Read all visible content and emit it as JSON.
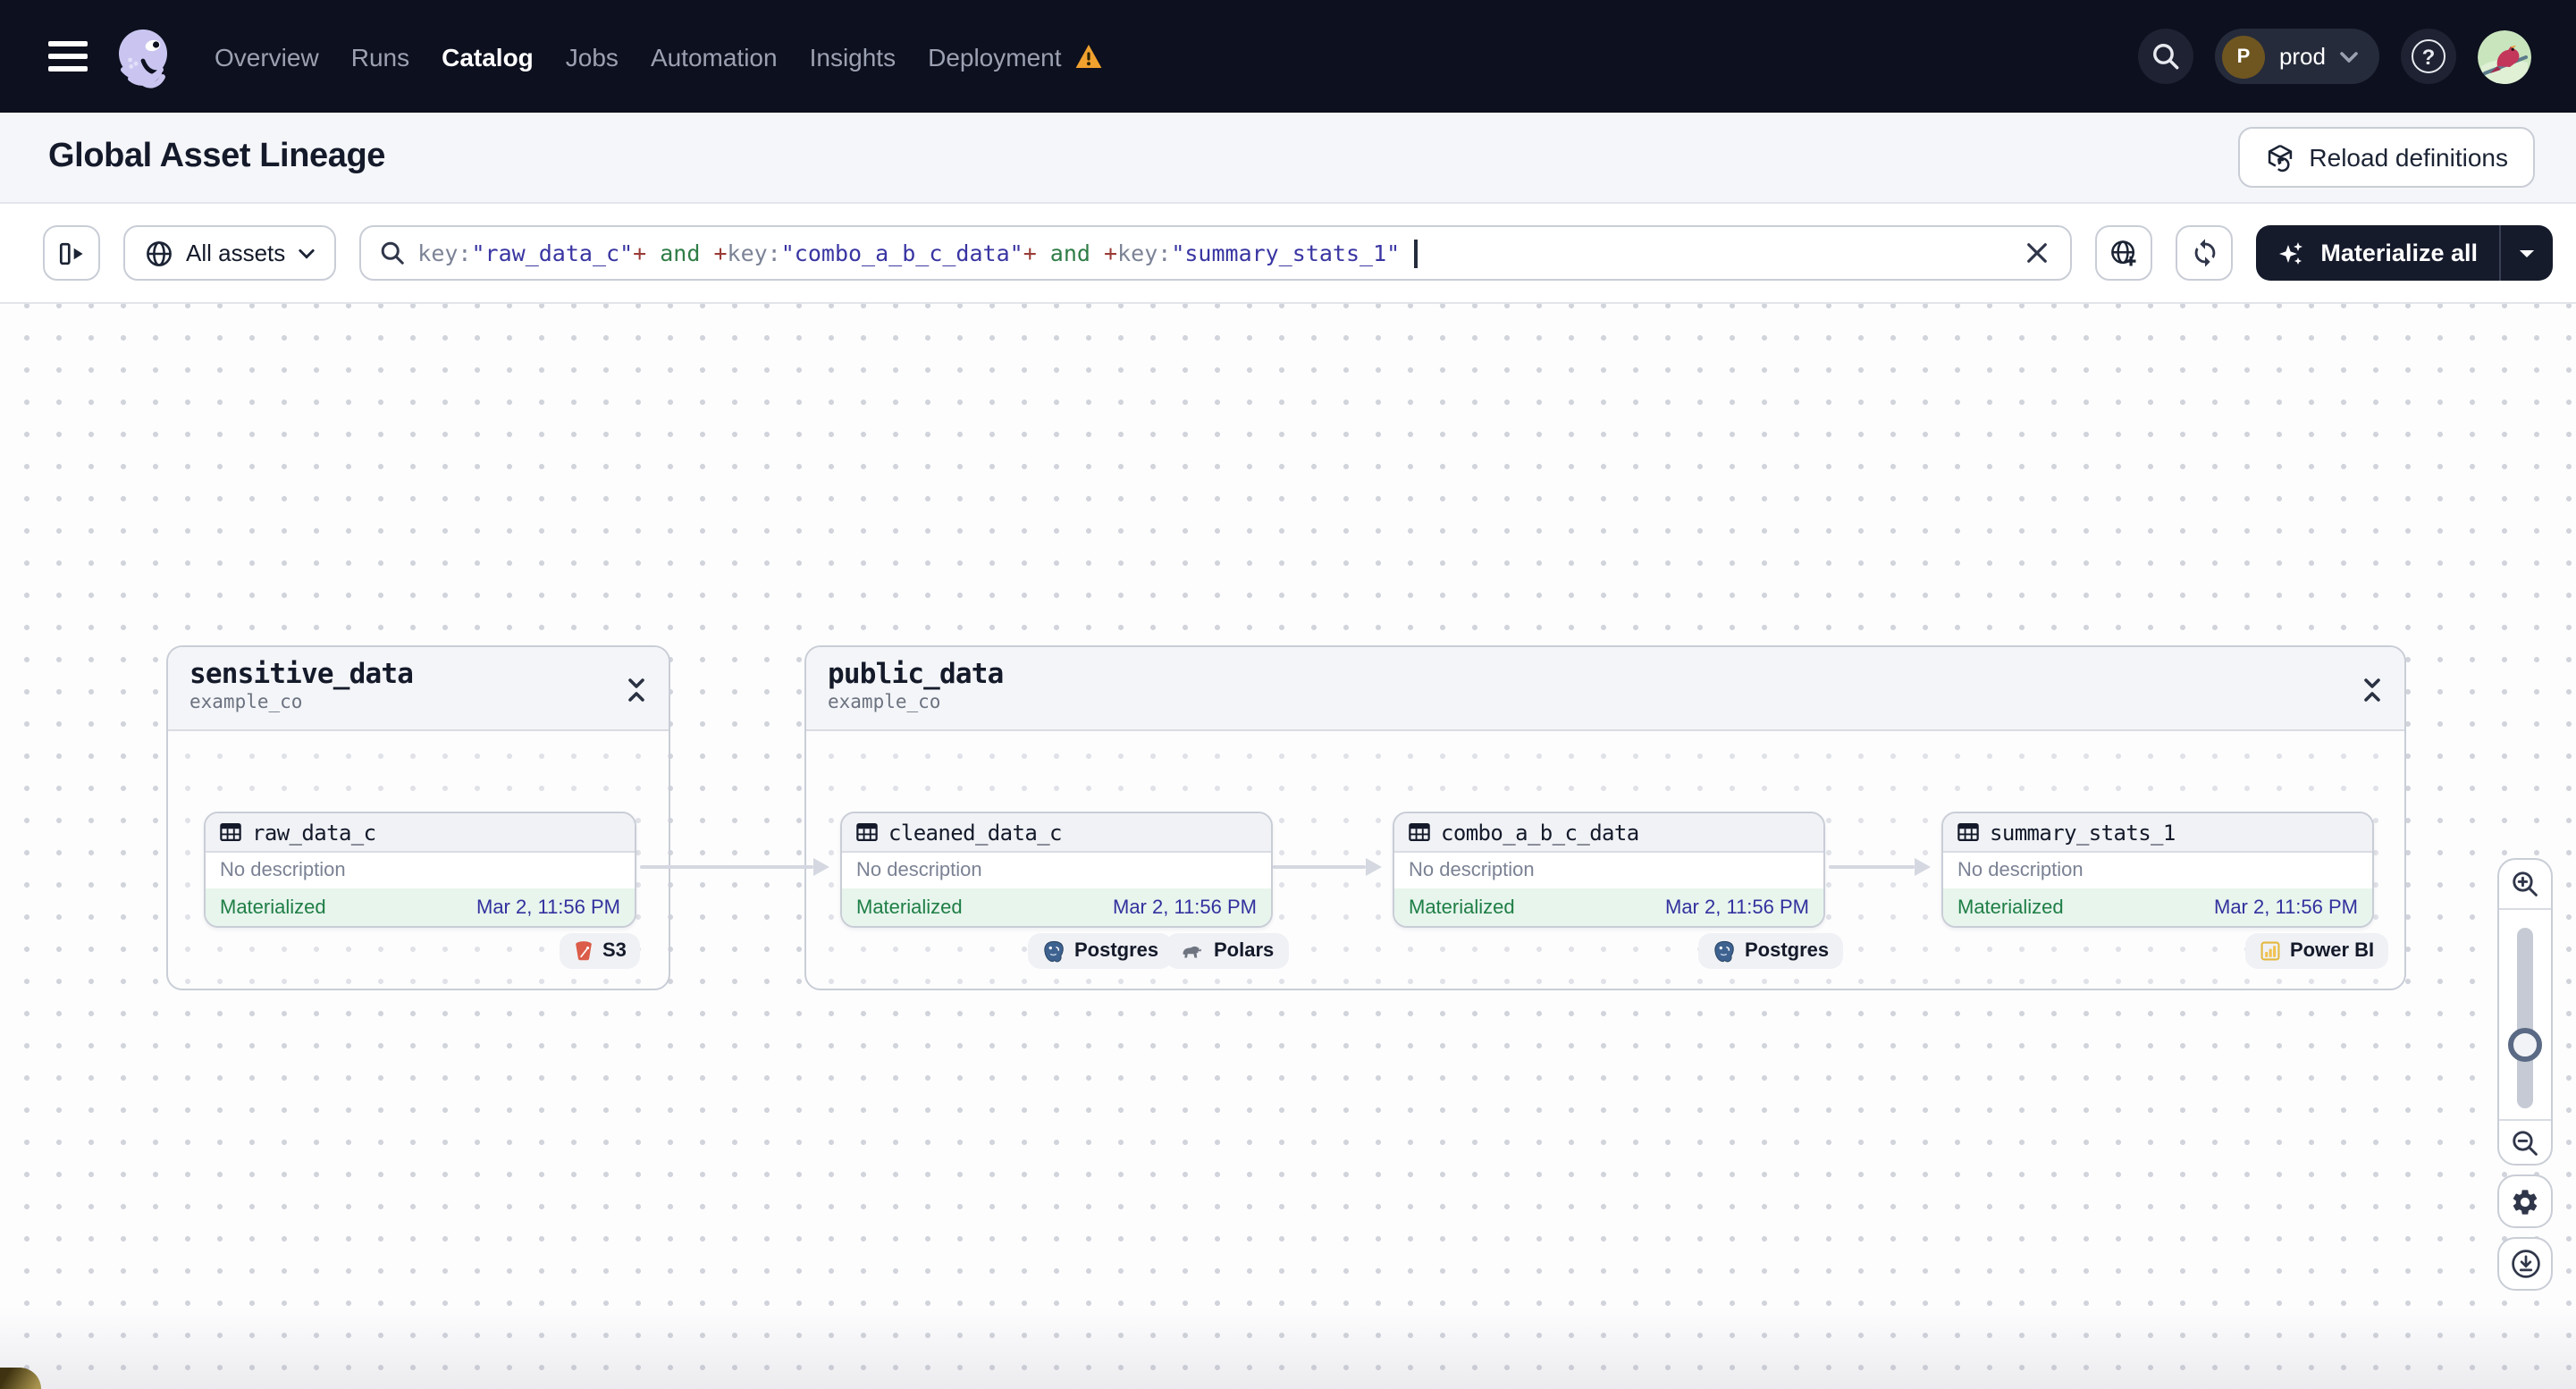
{
  "nav": {
    "menu_items": [
      {
        "label": "Overview",
        "active": false
      },
      {
        "label": "Runs",
        "active": false
      },
      {
        "label": "Catalog",
        "active": true
      },
      {
        "label": "Jobs",
        "active": false
      },
      {
        "label": "Automation",
        "active": false
      },
      {
        "label": "Insights",
        "active": false
      },
      {
        "label": "Deployment",
        "active": false,
        "warning": true
      }
    ],
    "deployment_badge": {
      "initial": "P",
      "name": "prod"
    },
    "help_label": "?"
  },
  "page": {
    "title": "Global Asset Lineage",
    "reload_button": "Reload definitions"
  },
  "toolbar": {
    "asset_filter": {
      "label": "All assets"
    },
    "search": {
      "tokens": [
        {
          "type": "key",
          "text": "key:"
        },
        {
          "type": "value",
          "text": "\"raw_data_c\""
        },
        {
          "type": "plus",
          "text": "+"
        },
        {
          "type": "and",
          "text": " and "
        },
        {
          "type": "plus",
          "text": "+"
        },
        {
          "type": "key",
          "text": "key:"
        },
        {
          "type": "value",
          "text": "\"combo_a_b_c_data\""
        },
        {
          "type": "plus",
          "text": "+"
        },
        {
          "type": "and",
          "text": " and "
        },
        {
          "type": "plus",
          "text": "+"
        },
        {
          "type": "key",
          "text": "key:"
        },
        {
          "type": "value",
          "text": "\"summary_stats_1\""
        }
      ]
    },
    "materialize_button": "Materialize all"
  },
  "graph": {
    "groups": [
      {
        "name": "sensitive_data",
        "location": "example_co"
      },
      {
        "name": "public_data",
        "location": "example_co"
      }
    ],
    "assets": [
      {
        "name": "raw_data_c",
        "description": "No description",
        "status": "Materialized",
        "timestamp": "Mar 2, 11:56 PM",
        "badges": [
          "S3"
        ]
      },
      {
        "name": "cleaned_data_c",
        "description": "No description",
        "status": "Materialized",
        "timestamp": "Mar 2, 11:56 PM",
        "badges": [
          "Postgres",
          "Polars"
        ]
      },
      {
        "name": "combo_a_b_c_data",
        "description": "No description",
        "status": "Materialized",
        "timestamp": "Mar 2, 11:56 PM",
        "badges": [
          "Postgres"
        ]
      },
      {
        "name": "summary_stats_1",
        "description": "No description",
        "status": "Materialized",
        "timestamp": "Mar 2, 11:56 PM",
        "badges": [
          "Power BI"
        ]
      }
    ]
  },
  "colors": {
    "nav_bg": "#0D101E",
    "band_bg": "#F5F6F9",
    "accent_dark": "#161B2C",
    "green": "#1E7E45",
    "green_bg": "#E7F5ED",
    "timestamp_blue": "#33319E",
    "tok_key": "#7C8396",
    "tok_value": "#3935A2",
    "tok_plus": "#9A3B37",
    "tok_and": "#2F7D46",
    "warning_orange": "#F0A12E",
    "s3_red": "#DB5C49",
    "postgres_blue": "#3E6290",
    "powerbi_yellow": "#F2C24E",
    "arrow": "#D5D8E0",
    "dot": "#D2D4DC"
  }
}
